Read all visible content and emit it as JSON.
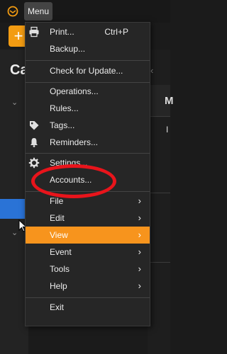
{
  "topbar": {
    "menu_label": "Menu"
  },
  "sidebar": {
    "title": "Ca"
  },
  "add_button": {
    "label": "+"
  },
  "right_panel": {
    "header_letter": "M",
    "cell_letter": "I"
  },
  "menu": {
    "items": [
      {
        "label": "Print...",
        "shortcut": "Ctrl+P",
        "icon": "printer-icon"
      },
      {
        "label": "Backup..."
      },
      {
        "label": "Check for Update..."
      },
      {
        "label": "Operations..."
      },
      {
        "label": "Rules..."
      },
      {
        "label": "Tags...",
        "icon": "tag-icon"
      },
      {
        "label": "Reminders...",
        "icon": "bell-icon"
      },
      {
        "label": "Settings...",
        "icon": "gear-icon"
      },
      {
        "label": "Accounts..."
      },
      {
        "label": "File",
        "submenu": true
      },
      {
        "label": "Edit",
        "submenu": true
      },
      {
        "label": "View",
        "submenu": true,
        "highlighted": true
      },
      {
        "label": "Event",
        "submenu": true
      },
      {
        "label": "Tools",
        "submenu": true
      },
      {
        "label": "Help",
        "submenu": true
      },
      {
        "label": "Exit"
      }
    ],
    "arrow_glyph": "›"
  },
  "colors": {
    "highlight": "#f7941d",
    "annotation": "#e8141b",
    "accent": "#f39c12"
  }
}
